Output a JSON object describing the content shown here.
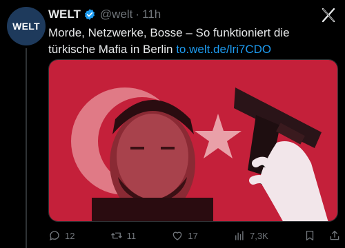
{
  "tweet": {
    "author_name": "WELT",
    "avatar_text": "WELT",
    "handle": "@welt",
    "separator": "·",
    "time": "11h",
    "text_main": "Morde, Netzwerke, Bosse – So funktioniert die türkische Mafia in Berlin",
    "link_text": "to.welt.de/lri7CDO"
  },
  "actions": {
    "replies": "12",
    "reposts": "11",
    "likes": "17",
    "views": "7,3K"
  },
  "icons": [
    "verified-badge-icon",
    "close-icon",
    "reply-icon",
    "repost-icon",
    "like-icon",
    "views-icon",
    "bookmark-icon",
    "share-icon"
  ],
  "colors": {
    "background": "#000000",
    "text": "#e7e9ea",
    "muted": "#71767b",
    "link": "#1d9bf0",
    "verified": "#1d9bf0",
    "avatar_bg": "#1e3a5c",
    "image_red": "#c4203a"
  }
}
